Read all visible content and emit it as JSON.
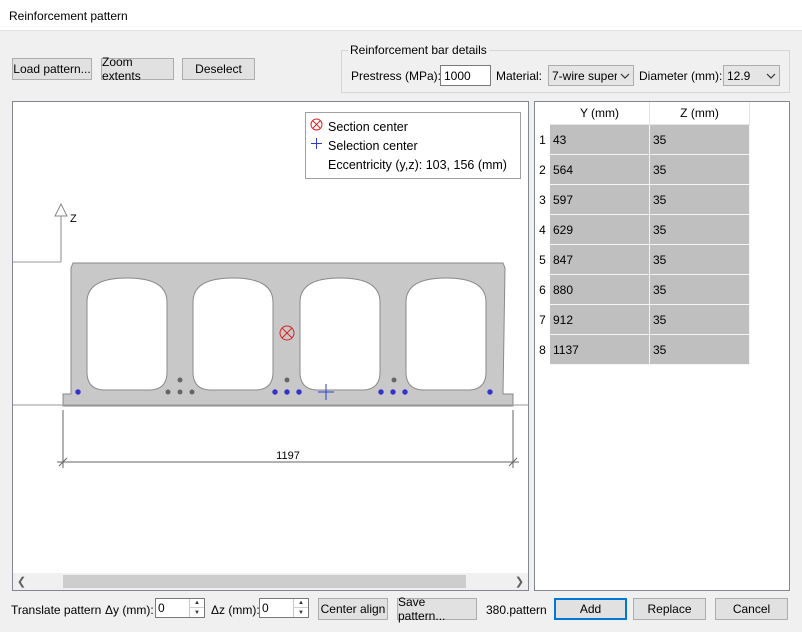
{
  "window": {
    "title": "Reinforcement pattern"
  },
  "toolbar": {
    "load_label": "Load pattern...",
    "zoom_label": "Zoom extents",
    "deselect_label": "Deselect"
  },
  "bar_details": {
    "group_title": "Reinforcement bar details",
    "prestress_label": "Prestress (MPa):",
    "prestress_value": "1000",
    "material_label": "Material:",
    "material_value": "7-wire super",
    "diameter_label": "Diameter (mm):",
    "diameter_value": "12.9"
  },
  "canvas": {
    "legend": {
      "section_center": "Section center",
      "selection_center": "Selection center",
      "eccentricity": "Eccentricity (y,z): 103, 156 (mm)"
    },
    "z_axis_label": "Z",
    "dimension_label": "1197",
    "colors": {
      "section_fill": "#c8c8c8",
      "bar_active": "#3333cc",
      "bar_inactive": "#666666",
      "section_center": "#e02020",
      "selection_center": "#2a3fd0"
    }
  },
  "table": {
    "columns": [
      "Y (mm)",
      "Z (mm)"
    ],
    "rows": [
      {
        "index": "1",
        "y": "43",
        "z": "35"
      },
      {
        "index": "2",
        "y": "564",
        "z": "35"
      },
      {
        "index": "3",
        "y": "597",
        "z": "35"
      },
      {
        "index": "4",
        "y": "629",
        "z": "35"
      },
      {
        "index": "5",
        "y": "847",
        "z": "35"
      },
      {
        "index": "6",
        "y": "880",
        "z": "35"
      },
      {
        "index": "7",
        "y": "912",
        "z": "35"
      },
      {
        "index": "8",
        "y": "1137",
        "z": "35"
      }
    ]
  },
  "bottom": {
    "translate_label": "Translate pattern",
    "dy_label": "Δy (mm):",
    "dy_value": "0",
    "dz_label": "Δz (mm):",
    "dz_value": "0",
    "center_align_label": "Center align",
    "save_pattern_label": "Save pattern...",
    "filename": "380.pattern",
    "add_label": "Add",
    "replace_label": "Replace",
    "cancel_label": "Cancel"
  }
}
